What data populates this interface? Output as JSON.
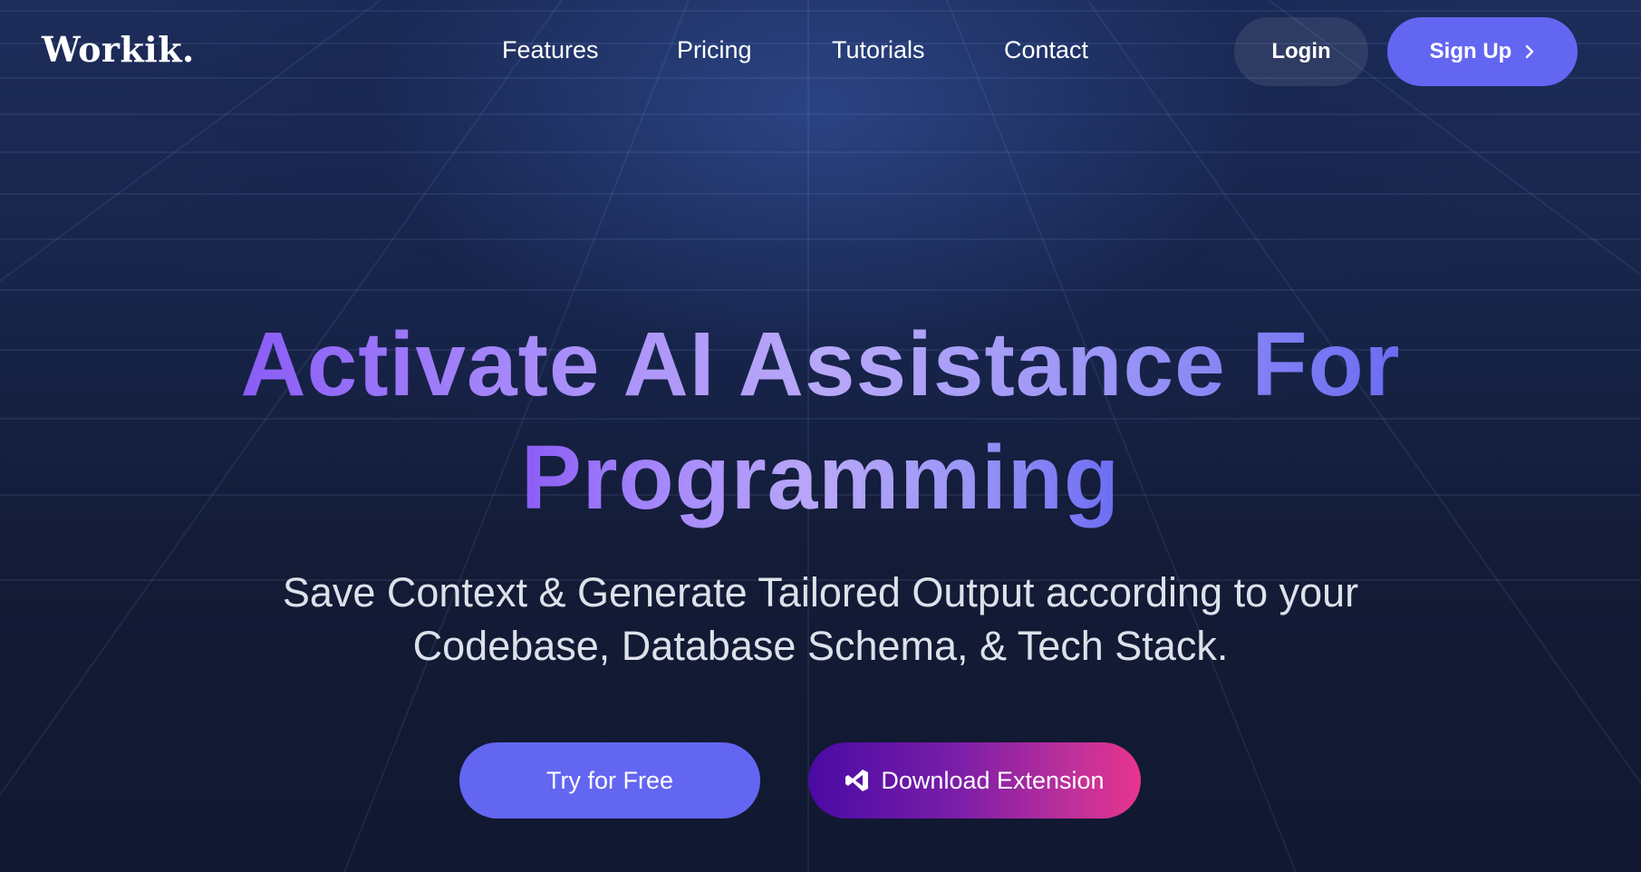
{
  "header": {
    "logo": "Workik.",
    "nav": [
      {
        "label": "Features"
      },
      {
        "label": "Pricing"
      },
      {
        "label": "Tutorials"
      },
      {
        "label": "Contact"
      }
    ],
    "login_label": "Login",
    "signup_label": "Sign Up"
  },
  "hero": {
    "title_line1": "Activate AI Assistance For",
    "title_line2": "Programming",
    "subtitle_line1": "Save Context & Generate Tailored Output according to your",
    "subtitle_line2": "Codebase, Database Schema, & Tech Stack."
  },
  "cta": {
    "try_label": "Try for Free",
    "download_label": "Download Extension"
  },
  "icons": {
    "signup": "chevron-right-icon",
    "download": "vscode-icon"
  },
  "colors": {
    "accent": "#6366f1",
    "background": "#121a33",
    "title_gradient_start": "#8b5cf6",
    "title_gradient_end": "#6b6cf2",
    "download_gradient_start": "#4a0aa4",
    "download_gradient_end": "#e8348e"
  }
}
